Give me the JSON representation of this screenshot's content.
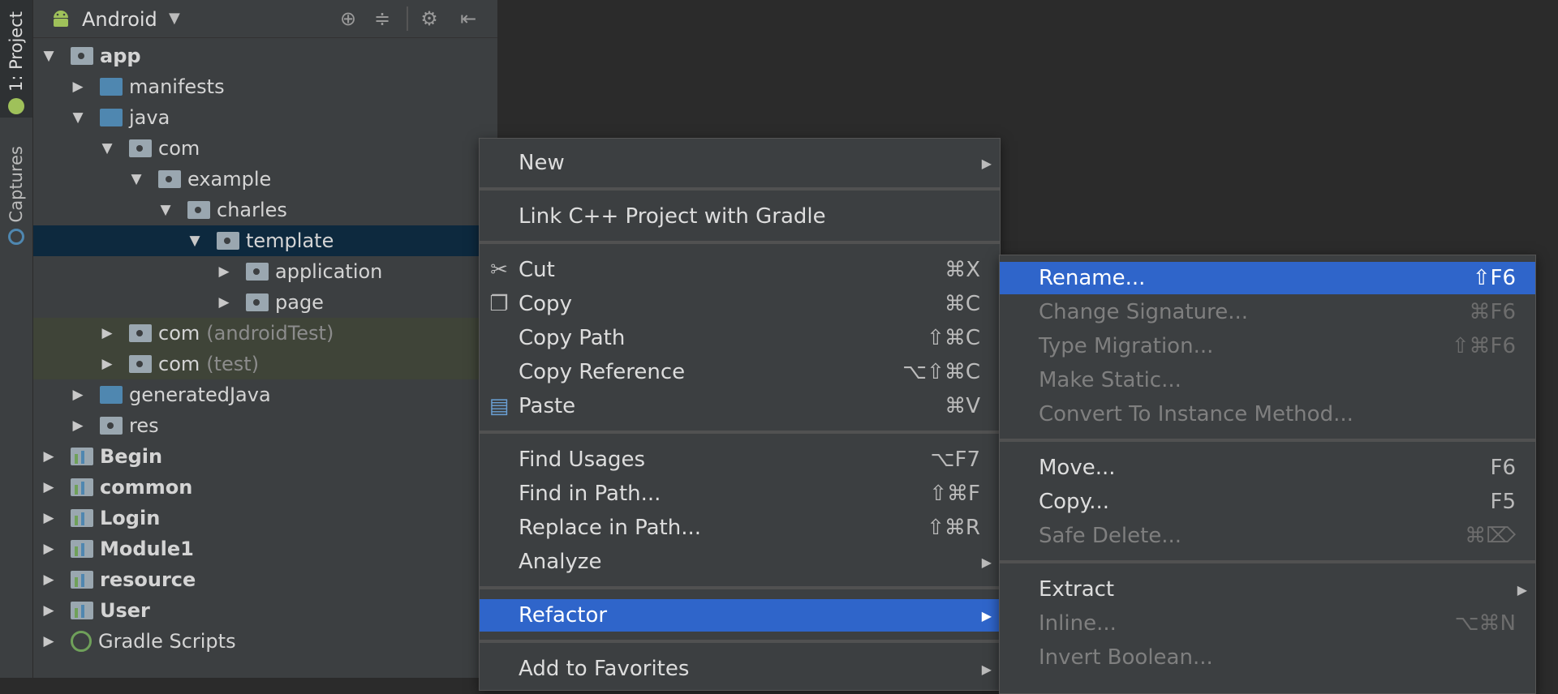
{
  "tool_strip": {
    "project_tab": "1: Project",
    "captures_tab": "Captures"
  },
  "toolbar": {
    "view_label": "Android",
    "icons": [
      "target-icon",
      "collapse-icon",
      "gear-icon",
      "hide-icon"
    ]
  },
  "tree": [
    {
      "label": "app",
      "arrow": "▼",
      "icon": "module-folder",
      "bold": true
    },
    {
      "label": "manifests",
      "arrow": "▶",
      "icon": "folder-blue"
    },
    {
      "label": "java",
      "arrow": "▼",
      "icon": "folder-blue"
    },
    {
      "label": "com",
      "arrow": "▼",
      "icon": "package"
    },
    {
      "label": "example",
      "arrow": "▼",
      "icon": "package"
    },
    {
      "label": "charles",
      "arrow": "▼",
      "icon": "package"
    },
    {
      "label": "template",
      "arrow": "▼",
      "icon": "package",
      "selected": true
    },
    {
      "label": "application",
      "arrow": "▶",
      "icon": "package"
    },
    {
      "label": "page",
      "arrow": "▶",
      "icon": "package"
    },
    {
      "label": "com",
      "suffix": "(androidTest)",
      "arrow": "▶",
      "icon": "package"
    },
    {
      "label": "com",
      "suffix": "(test)",
      "arrow": "▶",
      "icon": "package"
    },
    {
      "label": "generatedJava",
      "arrow": "▶",
      "icon": "folder-blue"
    },
    {
      "label": "res",
      "arrow": "▶",
      "icon": "folder-grey"
    },
    {
      "label": "Begin",
      "arrow": "▶",
      "icon": "module",
      "bold": true
    },
    {
      "label": "common",
      "arrow": "▶",
      "icon": "module",
      "bold": true
    },
    {
      "label": "Login",
      "arrow": "▶",
      "icon": "module",
      "bold": true
    },
    {
      "label": "Module1",
      "arrow": "▶",
      "icon": "module",
      "bold": true
    },
    {
      "label": "resource",
      "arrow": "▶",
      "icon": "module",
      "bold": true
    },
    {
      "label": "User",
      "arrow": "▶",
      "icon": "module",
      "bold": true
    },
    {
      "label": "Gradle Scripts",
      "arrow": "▶",
      "icon": "gradle"
    }
  ],
  "context_menu": {
    "new": "New",
    "link_cpp": "Link C++ Project with Gradle",
    "cut": "Cut",
    "cut_sc": "⌘X",
    "copy": "Copy",
    "copy_sc": "⌘C",
    "copy_path": "Copy Path",
    "copy_path_sc": "⇧⌘C",
    "copy_reference": "Copy Reference",
    "copy_reference_sc": "⌥⇧⌘C",
    "paste": "Paste",
    "paste_sc": "⌘V",
    "find_usages": "Find Usages",
    "find_usages_sc": "⌥F7",
    "find_in_path": "Find in Path...",
    "find_in_path_sc": "⇧⌘F",
    "replace_in_path": "Replace in Path...",
    "replace_in_path_sc": "⇧⌘R",
    "analyze": "Analyze",
    "refactor": "Refactor",
    "add_to_favorites": "Add to Favorites"
  },
  "refactor_menu": {
    "rename": "Rename...",
    "rename_sc": "⇧F6",
    "change_signature": "Change Signature...",
    "change_signature_sc": "⌘F6",
    "type_migration": "Type Migration...",
    "type_migration_sc": "⇧⌘F6",
    "make_static": "Make Static...",
    "convert_instance": "Convert To Instance Method...",
    "move": "Move...",
    "move_sc": "F6",
    "copy": "Copy...",
    "copy_sc": "F5",
    "safe_delete": "Safe Delete...",
    "safe_delete_sc": "⌘⌦",
    "extract": "Extract",
    "inline": "Inline...",
    "inline_sc": "⌥⌘N",
    "invert_boolean": "Invert Boolean..."
  },
  "colors": {
    "highlight": "#2f65ca",
    "selection": "#0d293e",
    "background": "#2b2b2b",
    "panel": "#3c3f41"
  }
}
